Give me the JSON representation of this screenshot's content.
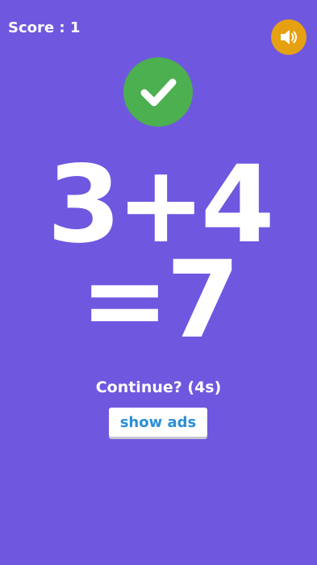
{
  "header": {
    "score_text": "Score : 1",
    "sound_icon": "speaker-volume-icon"
  },
  "result": {
    "icon": "checkmark-icon",
    "status": "correct",
    "colors": {
      "success": "#4caf50",
      "sound_button": "#e5a112",
      "background": "#7057e0"
    }
  },
  "equation": {
    "expression": "3+4",
    "answer_line": "=7"
  },
  "continue_prompt": {
    "text": "Continue? (4s)"
  },
  "ads_button": {
    "label": "show ads",
    "color": "#2b8fd6"
  }
}
